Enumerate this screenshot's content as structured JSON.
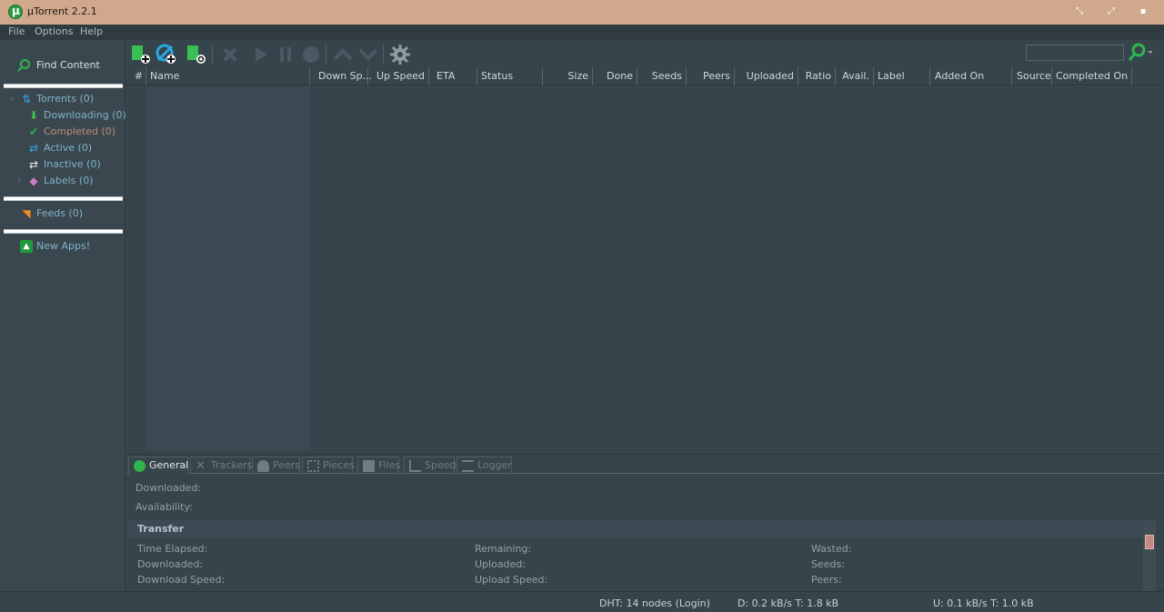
{
  "window": {
    "title": "µTorrent 2.2.1"
  },
  "menu": [
    "File",
    "Options",
    "Help"
  ],
  "sidebar": {
    "find_content": "Find Content",
    "items": [
      {
        "label": "Torrents (0)",
        "icon": "torrents-icon"
      },
      {
        "label": "Downloading (0)",
        "icon": "download-arrow-icon"
      },
      {
        "label": "Completed (0)",
        "icon": "checkmark-icon"
      },
      {
        "label": "Active (0)",
        "icon": "active-arrows-icon"
      },
      {
        "label": "Inactive (0)",
        "icon": "inactive-arrows-icon"
      },
      {
        "label": "Labels (0)",
        "icon": "tag-icon"
      }
    ],
    "feeds": "Feeds (0)",
    "apps": "New Apps!"
  },
  "columns": [
    "#",
    "Name",
    "Down Sp...",
    "Up Speed",
    "ETA",
    "Status",
    "Size",
    "Done",
    "Seeds",
    "Peers",
    "Uploaded",
    "Ratio",
    "Avail.",
    "Label",
    "Added On",
    "Source",
    "Completed On"
  ],
  "detail_tabs": [
    "General",
    "Trackers",
    "Peers",
    "Pieces",
    "Files",
    "Speed",
    "Logger"
  ],
  "general": {
    "downloaded": "Downloaded:",
    "availability": "Availability:",
    "transfer_header": "Transfer",
    "fields": [
      [
        "Time Elapsed:",
        "Remaining:",
        "Wasted:"
      ],
      [
        "Downloaded:",
        "Uploaded:",
        "Seeds:"
      ],
      [
        "Download Speed:",
        "Upload Speed:",
        "Peers:"
      ]
    ]
  },
  "status": {
    "dht": "DHT: 14 nodes (Login)",
    "down": "D: 0.2 kB/s T: 1.8 kB",
    "up": "U: 0.1 kB/s T: 1.0 kB"
  },
  "colors": {
    "accent": "#2fb54b",
    "titlebar": "#d0a88c",
    "background": "#36454c"
  }
}
